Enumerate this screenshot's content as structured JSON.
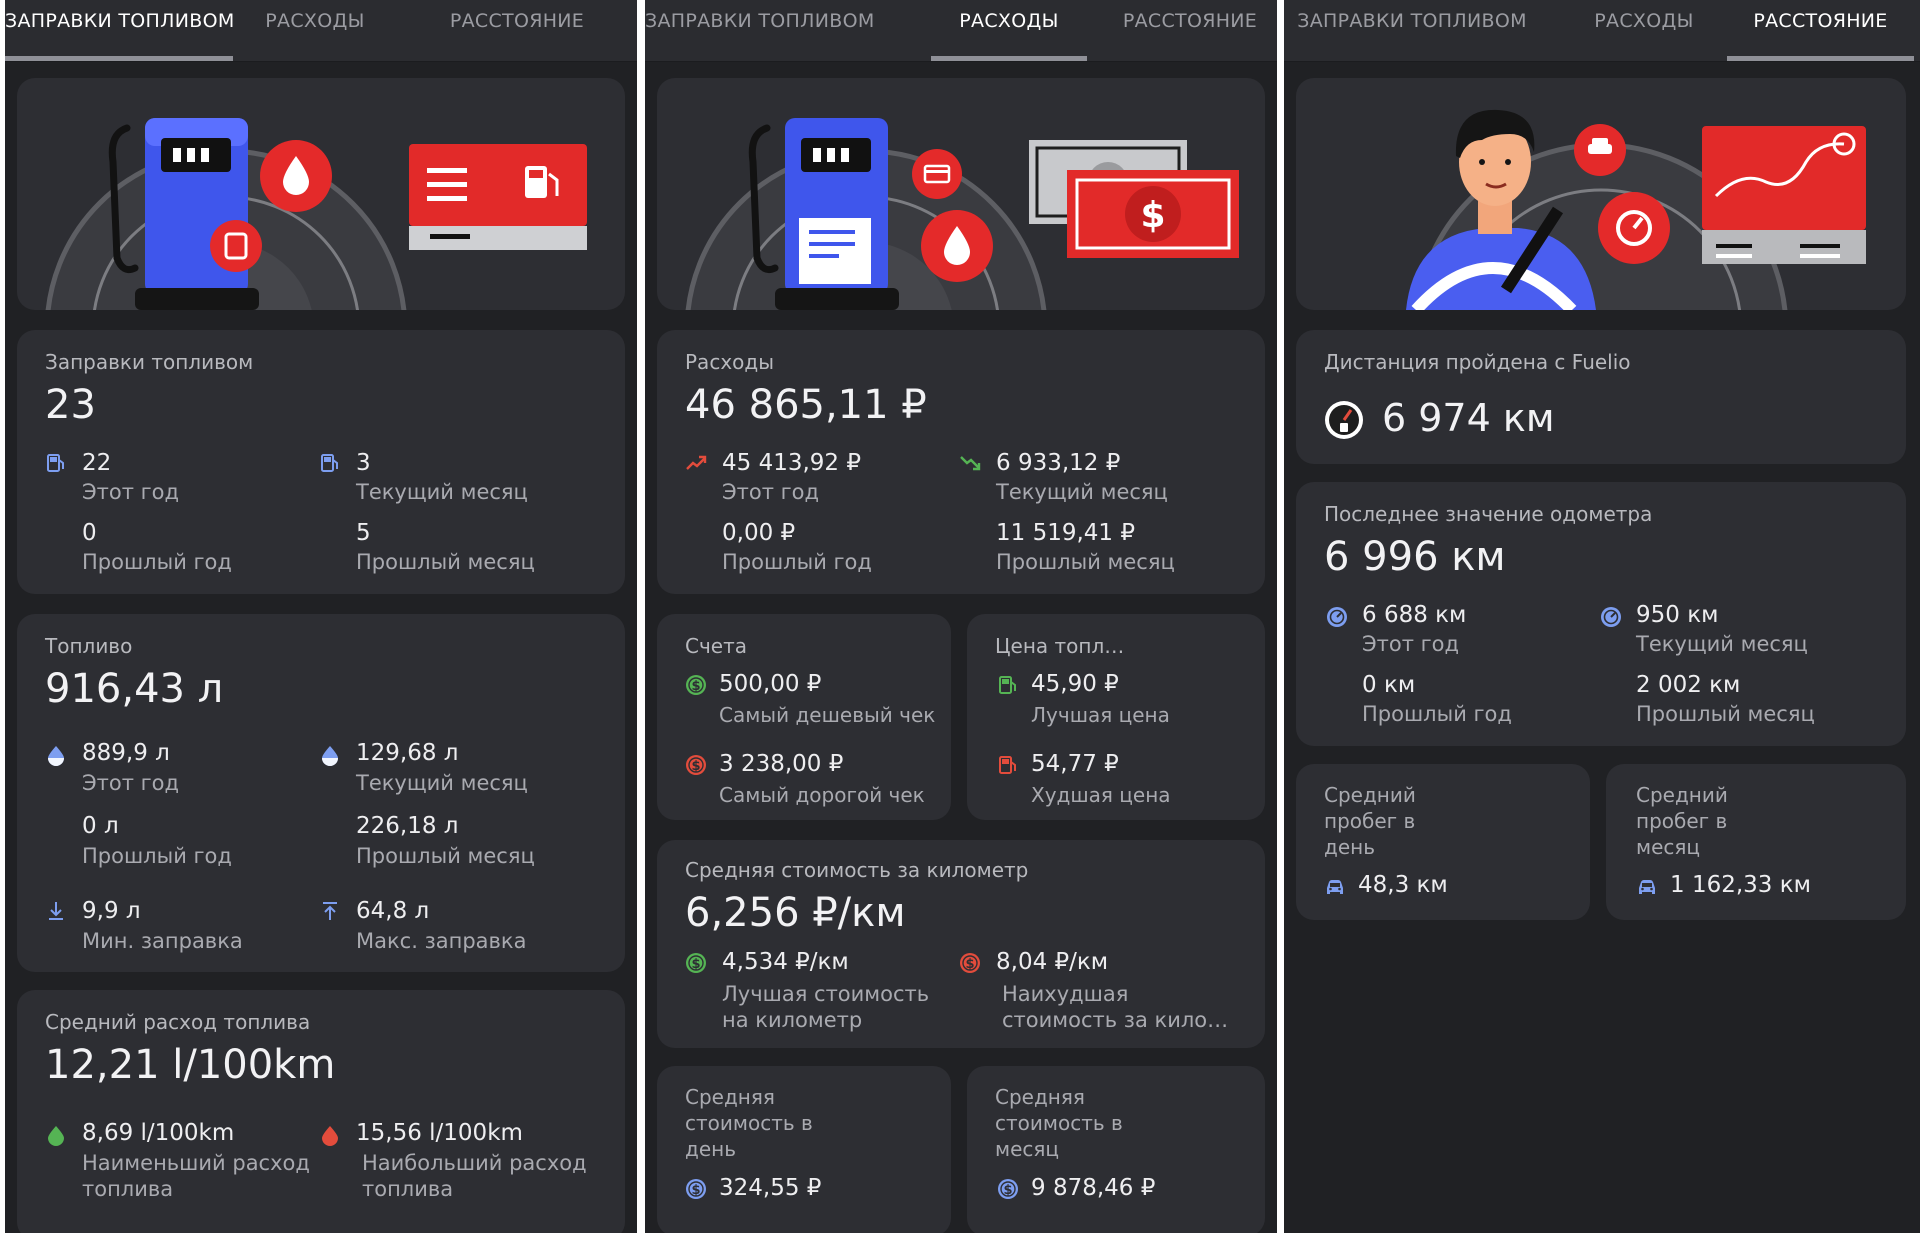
{
  "tabs": {
    "refuel": "ЗАПРАВКИ ТОПЛИВОМ",
    "expenses": "РАСХОДЫ",
    "distance": "РАССТОЯНИЕ"
  },
  "colors": {
    "background": "#202124",
    "card": "#2d2e33",
    "accent_red": "#e52b2b",
    "accent_blue": "#4a5ef0",
    "positive_green": "#55b454",
    "negative_red": "#e34c3c",
    "icon_blue": "#7d9ef0"
  },
  "refuel_panel": {
    "refuels": {
      "title": "Заправки топливом",
      "total": "23",
      "this_year_value": "22",
      "this_year_label": "Этот год",
      "current_month_value": "3",
      "current_month_label": "Текущий месяц",
      "last_year_value": "0",
      "last_year_label": "Прошлый год",
      "last_month_value": "5",
      "last_month_label": "Прошлый месяц",
      "icon": "fuel-pump-icon"
    },
    "fuel": {
      "title": "Топливо",
      "total": "916,43 л",
      "this_year_value": "889,9 л",
      "this_year_label": "Этот год",
      "current_month_value": "129,68 л",
      "current_month_label": "Текущий месяц",
      "last_year_value": "0 л",
      "last_year_label": "Прошлый год",
      "last_month_value": "226,18 л",
      "last_month_label": "Прошлый месяц",
      "min_value": "9,9 л",
      "min_label": "Мин. заправка",
      "max_value": "64,8 л",
      "max_label": "Макс. заправка",
      "icon": "fuel-drop-icon"
    },
    "consumption": {
      "title": "Средний расход топлива",
      "total": "12,21 l/100km",
      "min_value": "8,69 l/100km",
      "min_label": "Наименьший расход топлива",
      "max_value": "15,56 l/100km",
      "max_label": "Наибольший расход топлива"
    }
  },
  "expenses_panel": {
    "expenses": {
      "title": "Расходы",
      "total": "46 865,11 ₽",
      "this_year_value": "45 413,92 ₽",
      "this_year_label": "Этот год",
      "current_month_value": "6 933,12 ₽",
      "current_month_label": "Текущий месяц",
      "last_year_value": "0,00 ₽",
      "last_year_label": "Прошлый год",
      "last_month_value": "11 519,41 ₽",
      "last_month_label": "Прошлый месяц"
    },
    "bills": {
      "title": "Счета",
      "cheapest_value": "500,00 ₽",
      "cheapest_label": "Самый дешевый чек",
      "most_expensive_value": "3 238,00 ₽",
      "most_expensive_label": "Самый дорогой чек"
    },
    "fuel_price": {
      "title": "Цена топл…",
      "best_value": "45,90 ₽",
      "best_label": "Лучшая цена",
      "worst_value": "54,77 ₽",
      "worst_label": "Худшая цена"
    },
    "cost_per_km": {
      "title": "Средняя стоимость за километр",
      "total": "6,256 ₽/км",
      "best_value": "4,534 ₽/км",
      "best_label": "Лучшая стоимость на километр",
      "worst_value": "8,04 ₽/км",
      "worst_label": "Наихудшая стоимость за кило…"
    },
    "cost_per_day": {
      "title": "Средняя стоимость в день",
      "value": "324,55 ₽"
    },
    "cost_per_month": {
      "title": "Средняя стоимость в месяц",
      "value": "9 878,46 ₽"
    }
  },
  "distance_panel": {
    "since_fuelio": {
      "title": "Дистанция пройдена с Fuelio",
      "value": "6 974 км"
    },
    "odometer": {
      "title": "Последнее значение одометра",
      "total": "6 996 км",
      "this_year_value": "6 688 км",
      "this_year_label": "Этот год",
      "current_month_value": "950 км",
      "current_month_label": "Текущий месяц",
      "last_year_value": "0 км",
      "last_year_label": "Прошлый год",
      "last_month_value": "2 002 км",
      "last_month_label": "Прошлый месяц"
    },
    "daily_mileage": {
      "title": "Средний пробег в день",
      "value": "48,3 км"
    },
    "monthly_mileage": {
      "title": "Средний пробег в месяц",
      "value": "1 162,33 км"
    }
  }
}
